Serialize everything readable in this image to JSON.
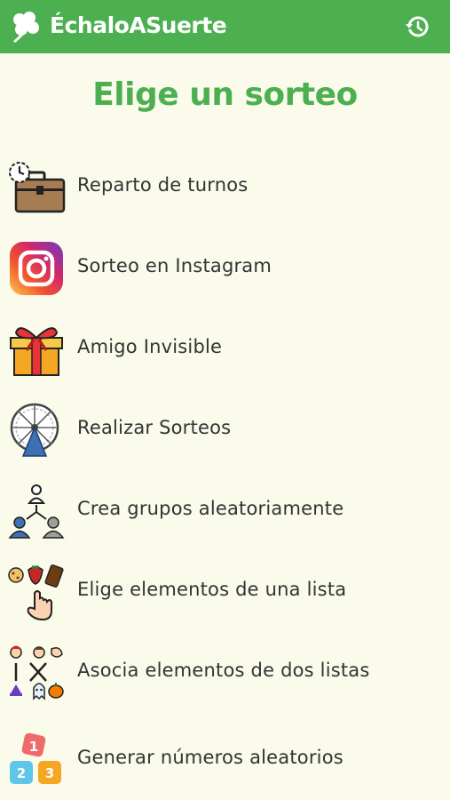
{
  "app": {
    "title": "ÉchaloASuerte"
  },
  "page": {
    "title": "Elige un sorteo"
  },
  "icons": {
    "logo": "clover-icon",
    "history": "history-icon"
  },
  "colors": {
    "brand": "#4caf50",
    "background": "#fafbea",
    "text": "#333333"
  },
  "menu": {
    "items": [
      {
        "label": "Reparto de turnos",
        "icon": "briefcase-clock-icon"
      },
      {
        "label": "Sorteo en Instagram",
        "icon": "instagram-icon"
      },
      {
        "label": "Amigo Invisible",
        "icon": "gift-icon"
      },
      {
        "label": "Realizar Sorteos",
        "icon": "lottery-drum-icon"
      },
      {
        "label": "Crea grupos aleatoriamente",
        "icon": "people-groups-icon"
      },
      {
        "label": "Elige elementos de una lista",
        "icon": "hand-pointer-items-icon"
      },
      {
        "label": "Asocia elementos de dos listas",
        "icon": "match-lists-icon"
      },
      {
        "label": "Generar números aleatorios",
        "icon": "number-dice-icon"
      }
    ]
  }
}
